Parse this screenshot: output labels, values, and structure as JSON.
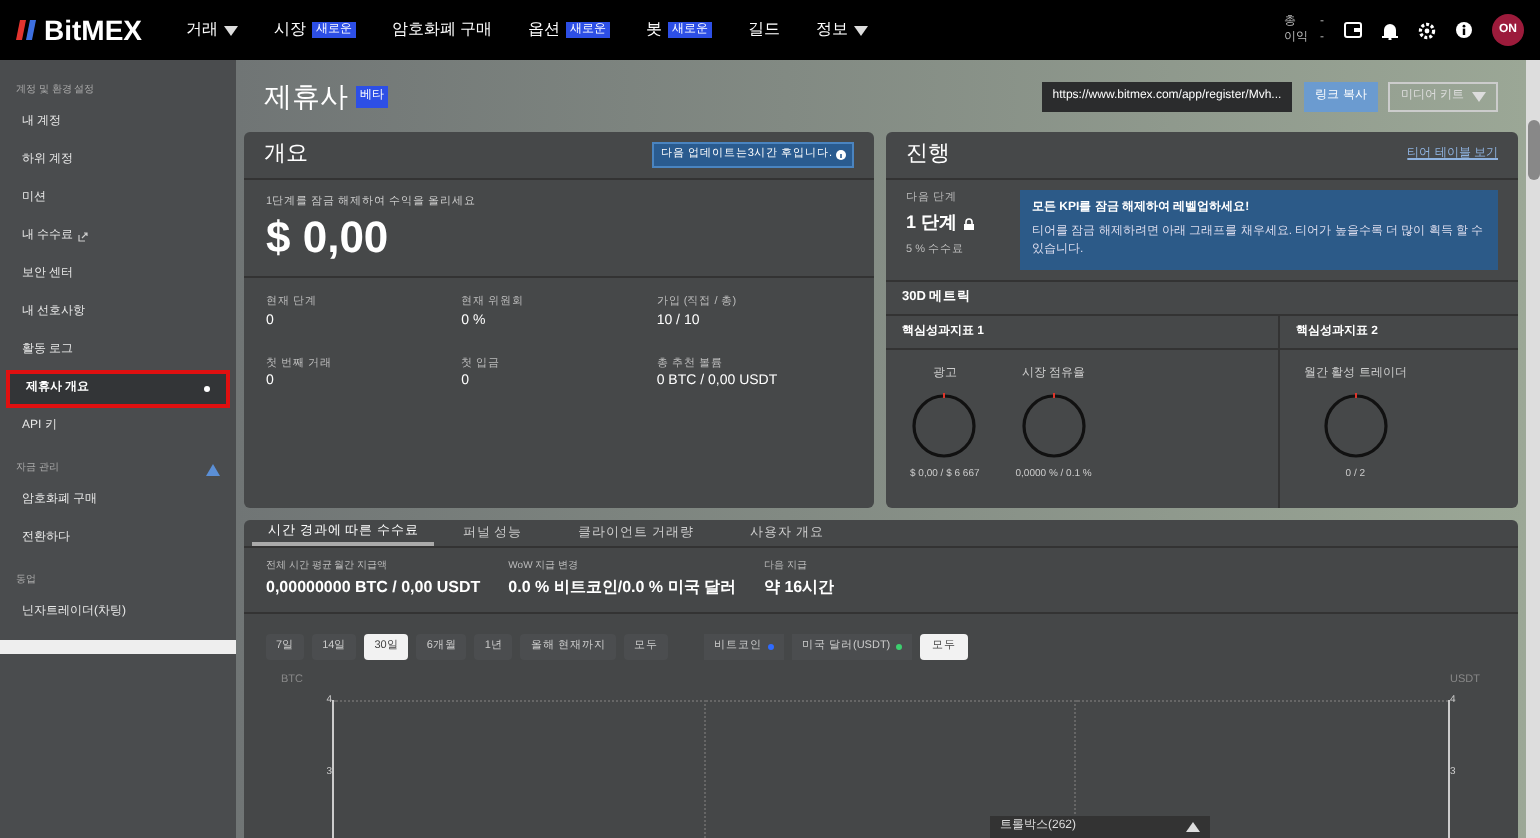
{
  "topnav": {
    "logo": "BitMEX",
    "items": [
      {
        "label": "거래",
        "kind": "dropdown"
      },
      {
        "label": "시장",
        "kind": "badge",
        "badge": "새로운"
      },
      {
        "label": "암호화폐 구매",
        "kind": "plain"
      },
      {
        "label": "옵션",
        "kind": "badge",
        "badge": "새로운"
      },
      {
        "label": "봇",
        "kind": "badge",
        "badge": "새로운"
      },
      {
        "label": "길드",
        "kind": "plain"
      },
      {
        "label": "정보",
        "kind": "dropdown"
      }
    ],
    "balance": [
      {
        "label": "총",
        "value": "-"
      },
      {
        "label": "이익",
        "value": "-"
      }
    ],
    "avatar": "ON"
  },
  "sidebar": {
    "sections": [
      {
        "title": "계정 및 환경 설정",
        "warning": false,
        "items": [
          {
            "label": "내 계정",
            "selected": false,
            "external": false
          },
          {
            "label": "하위 계정",
            "selected": false,
            "external": false
          },
          {
            "label": "미션",
            "selected": false,
            "external": false
          },
          {
            "label": "내 수수료",
            "selected": false,
            "external": true
          },
          {
            "label": "보안 센터",
            "selected": false,
            "external": false
          },
          {
            "label": "내 선호사항",
            "selected": false,
            "external": false
          },
          {
            "label": "활동 로그",
            "selected": false,
            "external": false
          },
          {
            "label": "제휴사 개요",
            "selected": true,
            "external": false
          },
          {
            "label": "API 키",
            "selected": false,
            "external": false
          }
        ]
      },
      {
        "title": "자금 관리",
        "warning": true,
        "items": [
          {
            "label": "암호화폐 구매",
            "selected": false,
            "external": false
          },
          {
            "label": "전환하다",
            "selected": false,
            "external": false
          }
        ]
      },
      {
        "title": "동업",
        "warning": false,
        "items": [
          {
            "label": "닌자트레이더(차팅)",
            "selected": false,
            "external": false
          }
        ]
      }
    ]
  },
  "page": {
    "title": "제휴사",
    "badge": "베타",
    "referral_link": "https://www.bitmex.com/app/register/Mvh...",
    "copy_button": "링크 복사",
    "media_kit_button": "미디어 키트"
  },
  "overview": {
    "title": "개요",
    "update_note": "다음 업데이트는3시간 후입니다.",
    "earn_label": "1단계를 잠금 해제하여 수익을 올리세요",
    "earn_value": "$ 0,00",
    "stats": [
      {
        "label": "현재 단계",
        "value": "0"
      },
      {
        "label": "현재 위원회",
        "value": "0 %"
      },
      {
        "label": "가입 (직접 / 총)",
        "value": "10 / 10"
      },
      {
        "label": "첫 번째 거래",
        "value": "0"
      },
      {
        "label": "첫 입금",
        "value": "0"
      },
      {
        "label": "총 추천 볼륨",
        "value": "0 BTC / 0,00 USDT"
      }
    ]
  },
  "progress": {
    "title": "진행",
    "tier_link": "티어 테이블 보기",
    "next_label": "다음 단계",
    "next_value": "1 단계",
    "fee": "5 % 수수료",
    "info_title": "모든 KPI를 잠금 해제하여 레벨업하세요!",
    "info_text": "티어를 잠금 해제하려면 아래 그래프를 채우세요. 티어가 높을수록 더 많이 획득 할 수 있습니다.",
    "metrics_title": "30D 메트릭",
    "kpi_groups": [
      {
        "title": "핵심성과지표 1",
        "gauges": [
          {
            "label": "광고",
            "level": 0,
            "reading": "$ 0,00 / $ 6 667"
          },
          {
            "label": "시장 점유율",
            "level": 0,
            "reading": "0,0000 % / 0.1 %"
          }
        ]
      },
      {
        "title": "핵심성과지표 2",
        "gauges": [
          {
            "label": "월간 활성 트레이더",
            "level": 0,
            "reading": "0 / 2"
          }
        ]
      }
    ]
  },
  "fees": {
    "tabs": [
      {
        "label": "시간 경과에 따른 수수료",
        "selected": true
      },
      {
        "label": "퍼널 성능",
        "selected": false
      },
      {
        "label": "클라이언트 거래량",
        "selected": false
      },
      {
        "label": "사용자 개요",
        "selected": false
      }
    ],
    "stats": [
      {
        "label": "전체 시간 평균 월간 지급액",
        "value": "0,00000000 BTC / 0,00 USDT"
      },
      {
        "label": "WoW 지급 변경",
        "value": "0.0 % 비트코인/0.0 % 미국 달러"
      },
      {
        "label": "다음 지급",
        "value": "약 16시간"
      }
    ],
    "ranges": [
      {
        "label": "7일",
        "selected": false
      },
      {
        "label": "14일",
        "selected": false
      },
      {
        "label": "30일",
        "selected": true
      },
      {
        "label": "6개월",
        "selected": false
      },
      {
        "label": "1년",
        "selected": false
      },
      {
        "label": "올해 현재까지",
        "selected": false
      },
      {
        "label": "모두",
        "selected": false
      }
    ],
    "legend": [
      {
        "label": "비트코인",
        "color": "#2f6bff"
      },
      {
        "label": "미국 달러(USDT)",
        "color": "#3ccf6e"
      }
    ],
    "all_button": {
      "label": "모두",
      "selected": true
    },
    "left_axis": {
      "label": "BTC",
      "ticks": [
        "4",
        "3"
      ]
    },
    "right_axis": {
      "label": "USDT",
      "ticks": [
        "4",
        "3"
      ]
    }
  },
  "trollbox": {
    "label": "트롤박스(262)"
  }
}
